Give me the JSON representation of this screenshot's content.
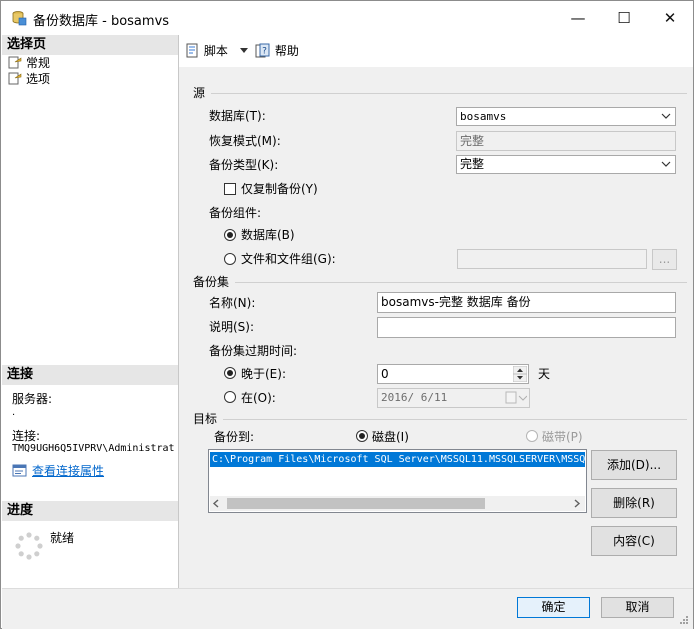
{
  "window": {
    "title": "备份数据库 - bosamvs",
    "minimize_glyph": "—",
    "maximize_glyph": "☐",
    "close_glyph": "✕"
  },
  "left": {
    "select_page_heading": "选择页",
    "pages": [
      {
        "label": "常规",
        "icon": "page-icon"
      },
      {
        "label": "选项",
        "icon": "page-icon"
      }
    ],
    "connection_heading": "连接",
    "server_label": "服务器:",
    "server_value": ".",
    "connection_label": "连接:",
    "connection_value": "TMQ9UGH6Q5IVPRV\\Administrat",
    "view_connection_link": "查看连接属性",
    "progress_heading": "进度",
    "progress_status": "就绪"
  },
  "toolbar": {
    "script_label": "脚本",
    "help_label": "帮助"
  },
  "source": {
    "heading": "源",
    "database_label": "数据库(T):",
    "database_value": "bosamvs",
    "recovery_label": "恢复模式(M):",
    "recovery_value": "完整",
    "backup_type_label": "备份类型(K):",
    "backup_type_value": "完整",
    "copy_only_label": "仅复制备份(Y)",
    "copy_only_checked": false,
    "component_label": "备份组件:",
    "component_database_label": "数据库(B)",
    "component_files_label": "文件和文件组(G):",
    "component_selected": "database",
    "files_value": "",
    "browse_label": "..."
  },
  "backup_set": {
    "heading": "备份集",
    "name_label": "名称(N):",
    "name_value": "bosamvs-完整 数据库 备份",
    "description_label": "说明(S):",
    "description_value": "",
    "expire_label": "备份集过期时间:",
    "after_label": "晚于(E):",
    "after_value": "0",
    "days_label": "天",
    "on_label": "在(O):",
    "on_value": "2016/ 6/11",
    "expire_selected": "after"
  },
  "destination": {
    "heading": "目标",
    "backup_to_label": "备份到:",
    "disk_label": "磁盘(I)",
    "tape_label": "磁带(P)",
    "selected": "disk",
    "paths": [
      "C:\\Program Files\\Microsoft SQL Server\\MSSQL11.MSSQLSERVER\\MSSQ"
    ],
    "add_label": "添加(D)...",
    "remove_label": "删除(R)",
    "contents_label": "内容(C)"
  },
  "footer": {
    "ok_label": "确定",
    "cancel_label": "取消"
  },
  "colors": {
    "selection": "#0078d7",
    "link": "#0066cc",
    "section_header_bg": "#e6e6e6",
    "panel_bg": "#f0f0f0",
    "default_button_border": "#0078d7"
  }
}
